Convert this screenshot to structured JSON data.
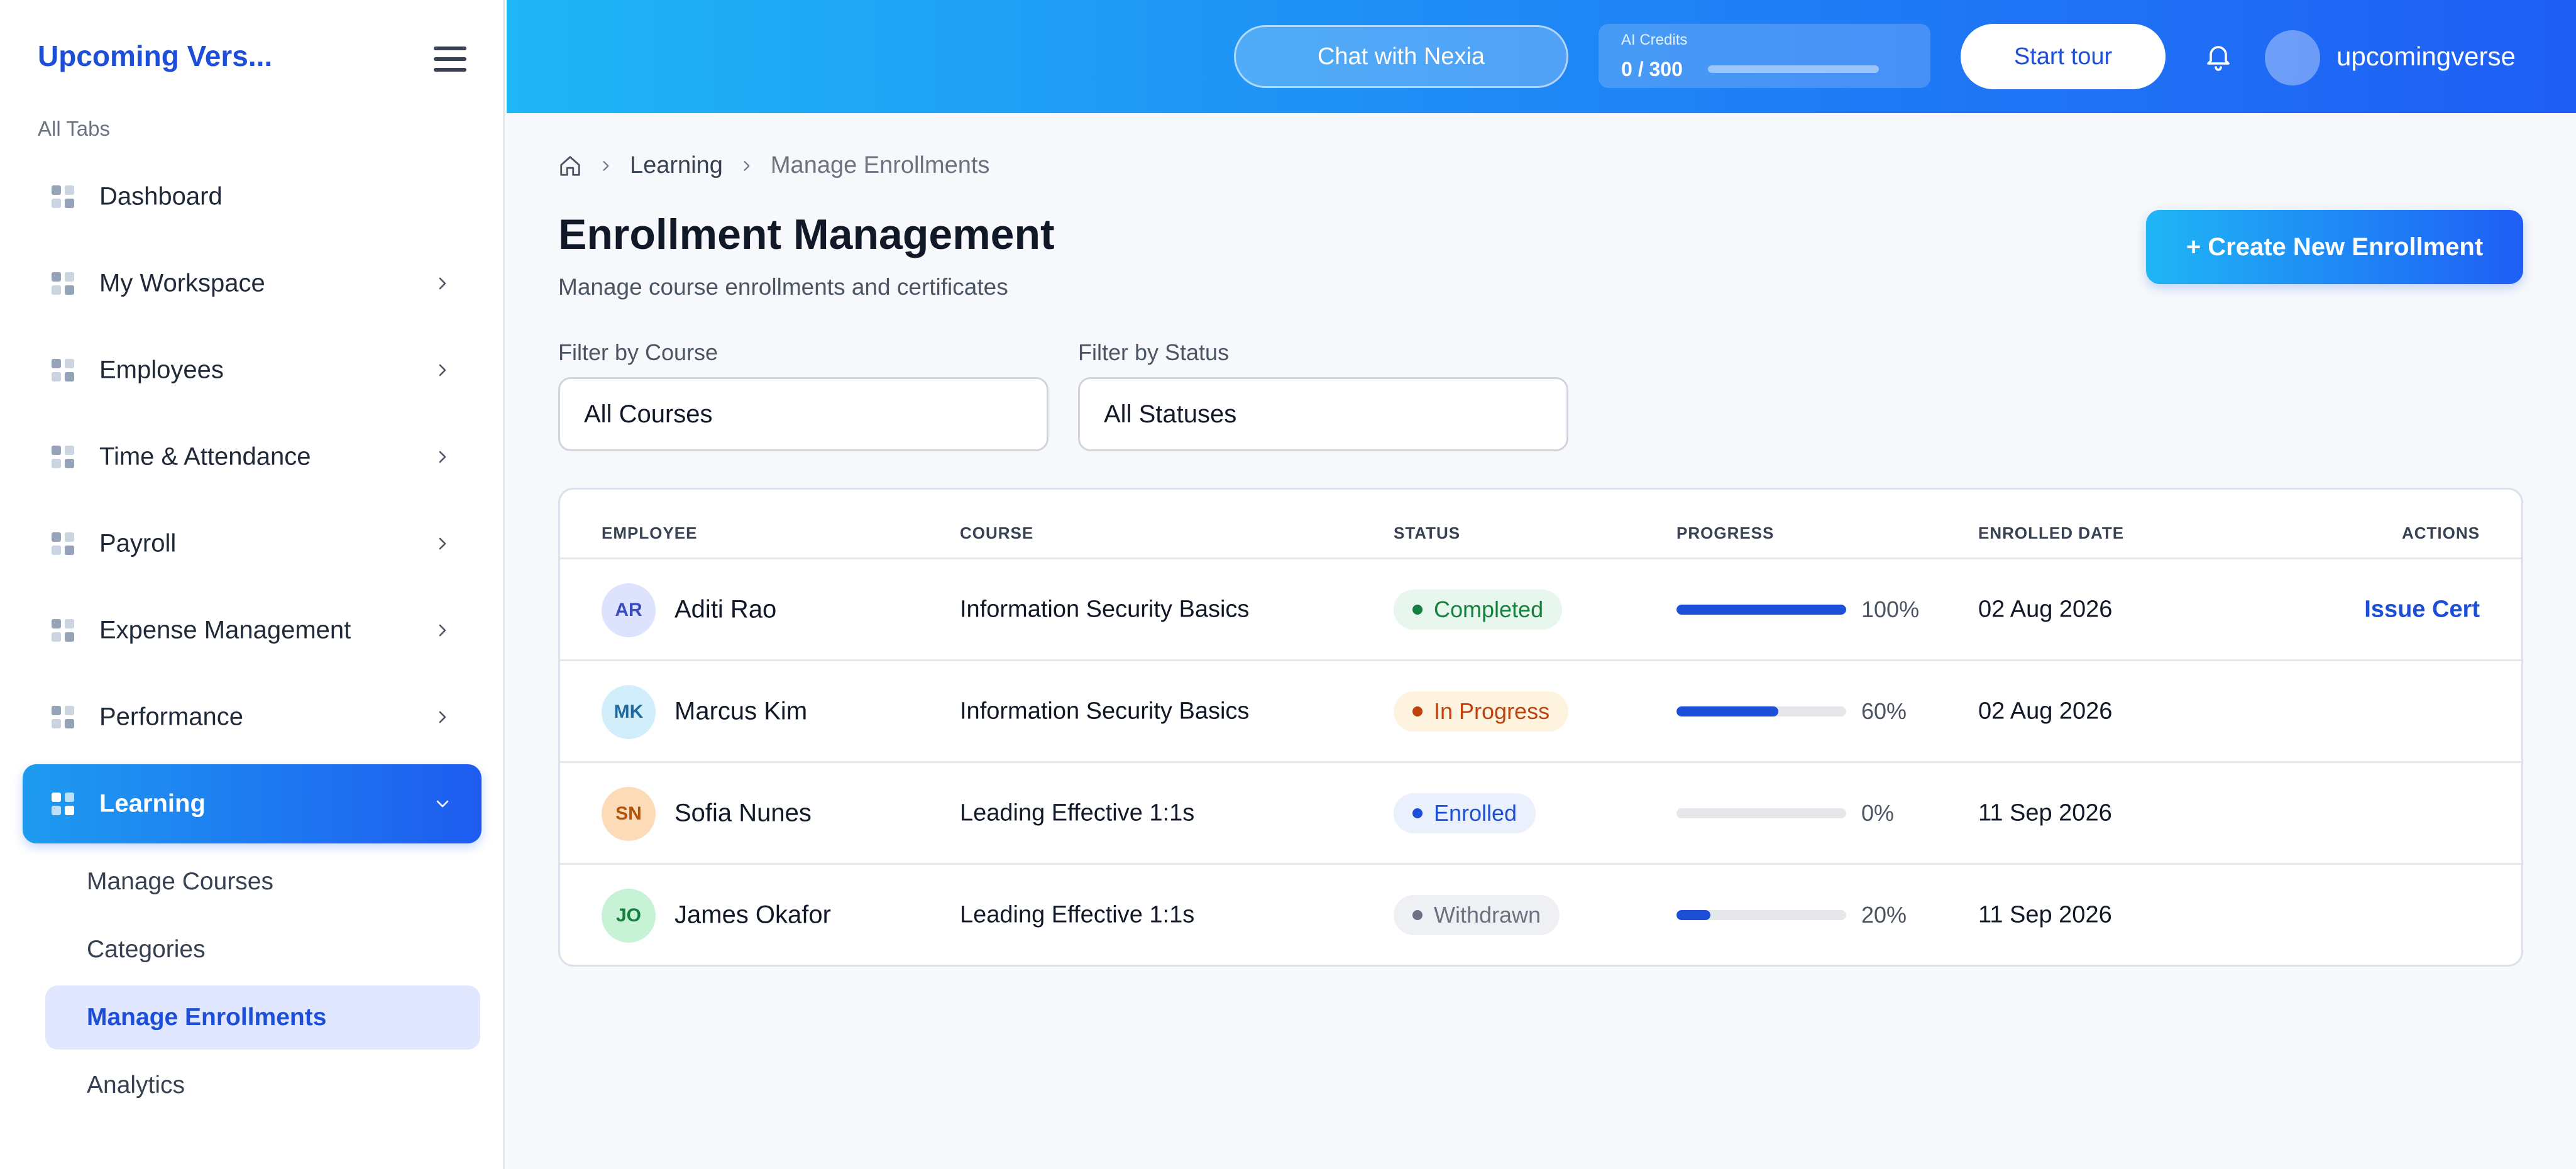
{
  "sidebar": {
    "brand": "Upcoming Vers...",
    "section_label": "All Tabs",
    "items": [
      {
        "label": "Dashboard"
      },
      {
        "label": "My Workspace"
      },
      {
        "label": "Employees"
      },
      {
        "label": "Time & Attendance"
      },
      {
        "label": "Payroll"
      },
      {
        "label": "Expense Management"
      },
      {
        "label": "Performance"
      },
      {
        "label": "Learning"
      }
    ],
    "sub_items": [
      {
        "label": "Manage Courses"
      },
      {
        "label": "Categories"
      },
      {
        "label": "Manage Enrollments"
      },
      {
        "label": "Analytics"
      }
    ]
  },
  "header": {
    "chat_label": "Chat with Nexia",
    "credits_label": "AI Credits",
    "credits_value": "0 / 300",
    "credits_fraction": 0,
    "tour_label": "Start tour",
    "username": "upcomingverse"
  },
  "breadcrumb": {
    "items": [
      "Learning",
      "Manage Enrollments"
    ]
  },
  "page": {
    "title": "Enrollment Management",
    "subtitle": "Manage course enrollments and certificates",
    "create_button": "+ Create New Enrollment"
  },
  "filters": {
    "course_label": "Filter by Course",
    "course_value": "All Courses",
    "status_label": "Filter by Status",
    "status_value": "All Statuses"
  },
  "table": {
    "headers": [
      "EMPLOYEE",
      "COURSE",
      "STATUS",
      "PROGRESS",
      "ENROLLED DATE",
      "ACTIONS"
    ],
    "rows": [
      {
        "initials": "AR",
        "name": "Aditi Rao",
        "course": "Information Security Basics",
        "status": "Completed",
        "progress": 100,
        "progress_label": "100%",
        "date": "02 Aug 2026",
        "action": "Issue Cert"
      },
      {
        "initials": "MK",
        "name": "Marcus Kim",
        "course": "Information Security Basics",
        "status": "In Progress",
        "progress": 60,
        "progress_label": "60%",
        "date": "02 Aug 2026",
        "action": ""
      },
      {
        "initials": "SN",
        "name": "Sofia Nunes",
        "course": "Leading Effective 1:1s",
        "status": "Enrolled",
        "progress": 0,
        "progress_label": "0%",
        "date": "11 Sep 2026",
        "action": ""
      },
      {
        "initials": "JO",
        "name": "James Okafor",
        "course": "Leading Effective 1:1s",
        "status": "Withdrawn",
        "progress": 20,
        "progress_label": "20%",
        "date": "11 Sep 2026",
        "action": ""
      }
    ]
  },
  "colors": {
    "accent": "#1d4ed8",
    "header_gradient_start": "#1fb6f5",
    "header_gradient_end": "#1f5ef5",
    "status_completed": "#15803d",
    "status_in_progress": "#c2410c",
    "status_enrolled": "#1d4ed8",
    "status_withdrawn": "#6b7280"
  }
}
